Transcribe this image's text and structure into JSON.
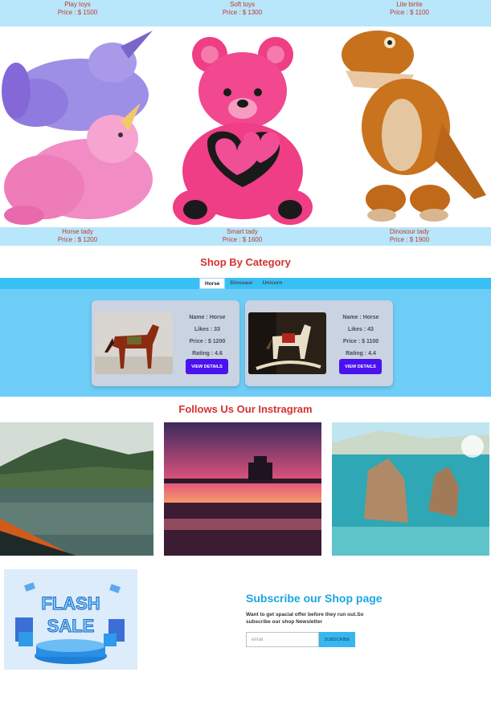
{
  "top_row": [
    {
      "name": "Play toys",
      "price": "Price : $ 1500"
    },
    {
      "name": "Soft toys",
      "price": "Price : $ 1300"
    },
    {
      "name": "Lite birite",
      "price": "Price : $ 1100"
    }
  ],
  "products": [
    {
      "name": "Horse tady",
      "price": "Price : $ 1200"
    },
    {
      "name": "Smart tady",
      "price": "Price : $ 1600"
    },
    {
      "name": "Dinosour tady",
      "price": "Price : $ 1900"
    }
  ],
  "category": {
    "title": "Shop By Category",
    "tabs": [
      "Horse",
      "Dinosaur",
      "Unicorn"
    ],
    "active_tab": "Horse",
    "cards": [
      {
        "name": "Name : Horse",
        "likes": "Likes : 33",
        "price": "Price : $ 1200",
        "rating": "Rating : 4.6",
        "button": "VIEW DETAILS"
      },
      {
        "name": "Name : Horse",
        "likes": "Likes : 43",
        "price": "Price : $ 1100",
        "rating": "Rating : 4.4",
        "button": "VIEW DETAILS"
      }
    ]
  },
  "instagram": {
    "title": "Follows Us Our Instragram"
  },
  "subscribe": {
    "title": "Subscribe our Shop page",
    "description": "Want to get spacial offer before they run out.So subscribe our shop Newsletter",
    "input_placeholder": "email",
    "button": "SUBSCRIBE"
  },
  "flash_sale": {
    "line1": "FLASH",
    "line2": "SALE"
  },
  "colors": {
    "accent": "#d63031",
    "band": "#b8e6fb",
    "tab_bar": "#38c0f5",
    "category_bg": "#6ecdf7",
    "button": "#4b12f0",
    "subscribe_title": "#1aa6e3"
  }
}
